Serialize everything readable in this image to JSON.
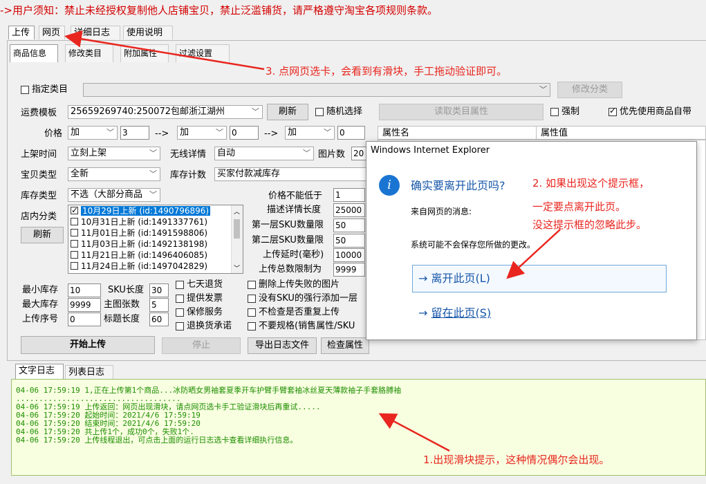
{
  "notice": "->用户须知：禁止未经授权复制他人店铺宝贝，禁止泛滥铺货，请严格遵守淘宝各项规则条款。",
  "main_tabs": [
    "上传",
    "网页",
    "详细日志",
    "使用说明"
  ],
  "sub_tabs": [
    "商品信息",
    "修改类目",
    "附加属性",
    "过滤设置"
  ],
  "form": {
    "specify_category_label": "指定类目",
    "modify_category_button": "修改分类",
    "shipping_template_label": "运费模板",
    "shipping_template_value": "25659269740:250072包邮浙江湖州",
    "refresh_button": "刷新",
    "random_select_label": "随机选择",
    "read_attrs_button": "读取类目属性",
    "force_label": "强制",
    "prefer_label": "优先使用商品自带",
    "price_label": "价格",
    "price_op1": "加",
    "price_val1": "3",
    "arrow1": "-->",
    "price_op2": "加",
    "price_val2": "0",
    "arrow2": "-->",
    "price_op3": "加",
    "price_val3": "0",
    "list_time_label": "上架时间",
    "list_time_value": "立刻上架",
    "wireless_label": "无线详情",
    "wireless_value": "自动",
    "img_count_label": "图片数",
    "img_count_value": "20",
    "item_type_label": "宝贝类型",
    "item_type_value": "全新",
    "stock_count_label": "库存计数",
    "stock_count_value": "买家付款减库存",
    "stock_type_label": "库存类型",
    "stock_type_value": "不选（大部分商品",
    "min_price_label": "价格不能低于",
    "min_price_value": "1",
    "store_cat_label": "店内分类",
    "store_refresh_button": "刷新",
    "desc_len_label": "描述详情长度",
    "desc_len_value": "25000",
    "sku1_label": "第一层SKU数量限",
    "sku1_value": "50",
    "sku2_label": "第二层SKU数量限",
    "sku2_value": "50",
    "delay_label": "上传延时(毫秒)",
    "delay_value": "10000",
    "total_label": "上传总数限制为",
    "total_value": "9999",
    "min_stock_label": "最小库存",
    "min_stock_value": "10",
    "sku_len_label": "SKU长度",
    "sku_len_value": "30",
    "max_stock_label": "最大库存",
    "max_stock_value": "9999",
    "main_img_label": "主图张数",
    "main_img_value": "5",
    "upload_seq_label": "上传序号",
    "upload_seq_value": "0",
    "title_len_label": "标题长度",
    "title_len_value": "60",
    "cb_7day": "七天退货",
    "cb_invoice": "提供发票",
    "cb_warranty": "保修服务",
    "cb_return": "退换货承诺",
    "cb_del_fail": "删除上传失败的图片",
    "cb_no_sku": "没有SKU的强行添加一层",
    "cb_no_dup": "不检查是否重复上传",
    "cb_no_spec": "不要规格(销售属性/SKU",
    "start_button": "开始上传",
    "stop_button": "停止",
    "export_button": "导出日志文件",
    "check_button": "检查属性"
  },
  "attr_table": {
    "col1": "属性名",
    "col2": "属性值"
  },
  "store_categories": [
    {
      "label": "10月29日上新 (id:1490796896)",
      "checked": true,
      "selected": true
    },
    {
      "label": "10月31日上新 (id:1491337761)",
      "checked": false,
      "selected": false
    },
    {
      "label": "11月01日上新 (id:1491598806)",
      "checked": false,
      "selected": false
    },
    {
      "label": "11月03日上新 (id:1492138198)",
      "checked": false,
      "selected": false
    },
    {
      "label": "11月21日上新 (id:1496406085)",
      "checked": false,
      "selected": false
    },
    {
      "label": "11月24日上新 (id:1497042829)",
      "checked": false,
      "selected": false
    }
  ],
  "log_tabs": [
    "文字日志",
    "列表日志"
  ],
  "log_lines": [
    "04-06 17:59:19 1,正在上传第1个商品...冰防晒女男袖套夏季开车护臂手臂套袖冰丝夏天薄款袖子手套胳膊袖",
    "....................................",
    "04-06 17:59:19 上传返回：网页出现滑块，请点网页选卡手工验证滑块后再重试.....",
    "04-06 17:59:20 起始时间：2021/4/6 17:59:19",
    "04-06 17:59:20 结束时间：2021/4/6 17:59:20",
    "04-06 17:59:20 共上传1个，成功0个，失败1个.",
    "04-06 17:59:20 上传线程退出，可点击上面的运行日志选卡查看详细执行信息。"
  ],
  "dialog": {
    "title": "Windows Internet Explorer",
    "question": "确实要离开此页吗?",
    "from_page": "来自网页的消息:",
    "message": "系统可能不会保存您所做的更改。",
    "leave_button": "离开此页(L)",
    "stay_button": "留在此页(S)"
  },
  "annotations": {
    "step3": "3. 点网页选卡，会看到有滑块，手工拖动验证即可。",
    "step2_line1": "2. 如果出现这个提示框，",
    "step2_line2": "一定要点离开此页。",
    "step2_line3": "没这提示框的忽略此步。",
    "step1": "1.出现滑块提示，这种情况偶尔会出现。"
  },
  "colors": {
    "annotation": "#e8261f",
    "notice": "#d40000",
    "log_text": "#1d8c00",
    "link_blue": "#1656a8"
  }
}
